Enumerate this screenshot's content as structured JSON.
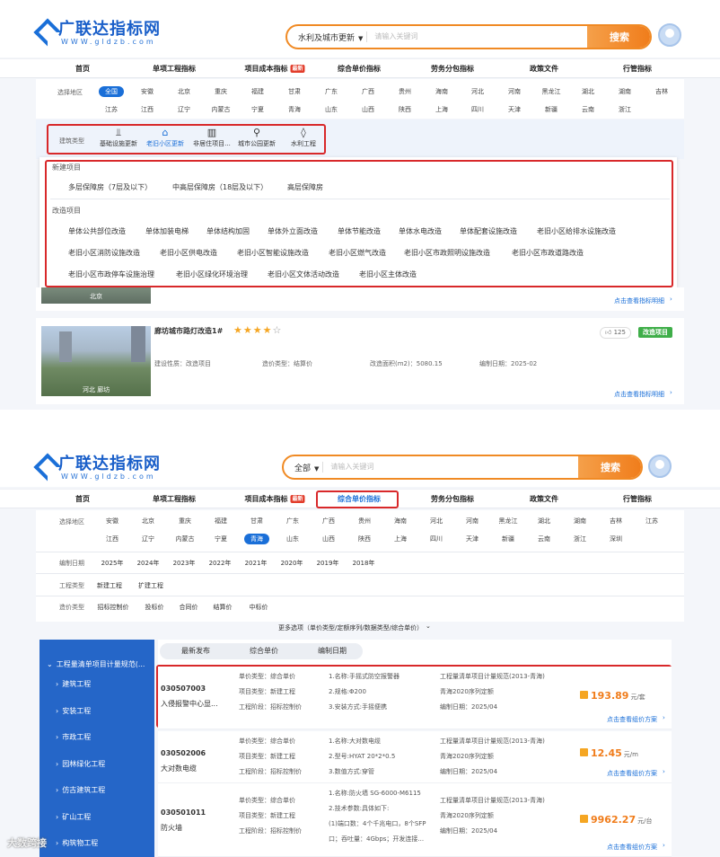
{
  "brand": {
    "name": "广联达指标网",
    "url": "WWW.gldzb.com"
  },
  "shot1": {
    "search_category": "水利及城市更新",
    "search_placeholder": "请输入关键词",
    "search_button": "搜索",
    "nav": [
      {
        "label": "首页"
      },
      {
        "label": "单项工程指标"
      },
      {
        "label": "项目成本指标",
        "badge": "最新"
      },
      {
        "label": "综合单价指标"
      },
      {
        "label": "劳务分包指标"
      },
      {
        "label": "政策文件"
      },
      {
        "label": "行管指标"
      }
    ],
    "region_label": "选择地区",
    "regions_row1": [
      "全国",
      "安徽",
      "北京",
      "重庆",
      "福建",
      "甘肃",
      "广东",
      "广西",
      "贵州",
      "海南",
      "河北",
      "河南",
      "黑龙江",
      "湖北",
      "湖南",
      "吉林"
    ],
    "regions_row2": [
      "江苏",
      "江西",
      "辽宁",
      "内蒙古",
      "宁夏",
      "青海",
      "山东",
      "山西",
      "陕西",
      "上海",
      "四川",
      "天津",
      "新疆",
      "云南",
      "浙江"
    ],
    "building_type_label": "建筑类型",
    "building_types": [
      {
        "label": "基础设施更新",
        "icon": "infrastructure-icon"
      },
      {
        "label": "老旧小区更新",
        "icon": "home-icon"
      },
      {
        "label": "非居住项目...",
        "icon": "building-icon"
      },
      {
        "label": "城市公园更新",
        "icon": "park-icon"
      },
      {
        "label": "水利工程",
        "icon": "water-drop-icon"
      }
    ],
    "dropdown": {
      "new_title": "新建项目",
      "new_items": [
        "多层保障房（7层及以下）",
        "中高层保障房（18层及以下）",
        "高层保障房"
      ],
      "reno_title": "改造项目",
      "reno_row1": [
        "单体公共部位改造",
        "单体加装电梯",
        "单体结构加固",
        "单体外立面改造",
        "单体节能改造",
        "单体水电改造",
        "单体配套设施改造",
        "老旧小区给排水设施改造"
      ],
      "reno_row2": [
        "老旧小区消防设施改造",
        "老旧小区供电改造",
        "老旧小区智能设施改造",
        "老旧小区燃气改造",
        "老旧小区市政照明设施改造",
        "老旧小区市政道路改造"
      ],
      "reno_row3": [
        "老旧小区市政停车设施治理",
        "老旧小区绿化环境治理",
        "老旧小区文体活动改造",
        "老旧小区主体改造"
      ]
    },
    "card1": {
      "location": "北京",
      "detail_link": "点击查看指标明细"
    },
    "card2": {
      "title": "廊坊城市路灯改造1#",
      "rating": 4,
      "likes": "125",
      "tag": "改造项目",
      "location": "河北 廊坊",
      "meta": [
        "建设性质：改造项目",
        "造价类型：结算价",
        "改造面积(m2)：5080.15",
        "编制日期：2025-02"
      ],
      "detail_link": "点击查看指标明细"
    }
  },
  "shot2": {
    "search_category": "全部",
    "search_placeholder": "请输入关键词",
    "search_button": "搜索",
    "nav": [
      {
        "label": "首页"
      },
      {
        "label": "单项工程指标"
      },
      {
        "label": "项目成本指标",
        "badge": "最新"
      },
      {
        "label": "综合单价指标",
        "active": true
      },
      {
        "label": "劳务分包指标"
      },
      {
        "label": "政策文件"
      },
      {
        "label": "行管指标"
      }
    ],
    "region_label": "选择地区",
    "regions_row1": [
      "安徽",
      "北京",
      "重庆",
      "福建",
      "甘肃",
      "广东",
      "广西",
      "贵州",
      "海南",
      "河北",
      "河南",
      "黑龙江",
      "湖北",
      "湖南",
      "吉林",
      "江苏"
    ],
    "regions_row2": [
      "江西",
      "辽宁",
      "内蒙古",
      "宁夏",
      "青海",
      "山东",
      "山西",
      "陕西",
      "上海",
      "四川",
      "天津",
      "新疆",
      "云南",
      "浙江",
      "深圳"
    ],
    "active_region": "青海",
    "date_label": "编制日期",
    "dates": [
      "2025年",
      "2024年",
      "2023年",
      "2022年",
      "2021年",
      "2020年",
      "2019年",
      "2018年"
    ],
    "eng_type_label": "工程类型",
    "eng_types": [
      "新建工程",
      "扩建工程"
    ],
    "price_type_label": "造价类型",
    "price_types": [
      "招标控制价",
      "投标价",
      "合同价",
      "结算价",
      "中标价"
    ],
    "more_options": "更多选项（单价类型/定额序列/数据类型/综合单价）",
    "sidebar": [
      "工程量清单项目计量规范(...",
      "建筑工程",
      "安装工程",
      "市政工程",
      "园林绿化工程",
      "仿古建筑工程",
      "矿山工程",
      "构筑物工程"
    ],
    "tabs": [
      "最新发布",
      "综合单价",
      "编制日期"
    ],
    "rows": [
      {
        "code": "030507003",
        "name": "入侵报警中心显...",
        "col1": [
          "单价类型：综合单价",
          "项目类型：新建工程",
          "工程阶段：招标控制价"
        ],
        "col2": [
          "1.名称:手摇式防空报警器",
          "2.规格:Φ200",
          "3.安装方式:手摇便携"
        ],
        "col3": [
          "工程量清单项目计量规范(2013-青海)",
          "青海2020序列定额",
          "编制日期：2025/04"
        ],
        "price": "193.89",
        "unit": "元/套",
        "link": "点击查看组价方案"
      },
      {
        "code": "030502006",
        "name": "大对数电缆",
        "col1": [
          "单价类型：综合单价",
          "项目类型：新建工程",
          "工程阶段：招标控制价"
        ],
        "col2": [
          "1.名称:大对数电缆",
          "2.型号:HYAT 20*2*0.5",
          "3.数值方式:穿管"
        ],
        "col3": [
          "工程量清单项目计量规范(2013-青海)",
          "青海2020序列定额",
          "编制日期：2025/04"
        ],
        "price": "12.45",
        "unit": "元/m",
        "link": "点击查看组价方案"
      },
      {
        "code": "030501011",
        "name": "防火墙",
        "col1": [
          "单价类型：综合单价",
          "项目类型：新建工程",
          "工程阶段：招标控制价"
        ],
        "col2": [
          "1.名称:防火墙 SG-6000-M6115",
          "2.技术参数:具体如下:",
          "(1)端口数：4个千兆电口，8个SFP",
          "口；吞吐量：4Gbps；开发连接..."
        ],
        "col3": [
          "工程量清单项目计量规范(2013-青海)",
          "青海2020序列定额",
          "编制日期：2025/04"
        ],
        "price": "9962.27",
        "unit": "元/台",
        "link": "点击查看组价方案"
      }
    ]
  },
  "watermark": "大数跨接"
}
